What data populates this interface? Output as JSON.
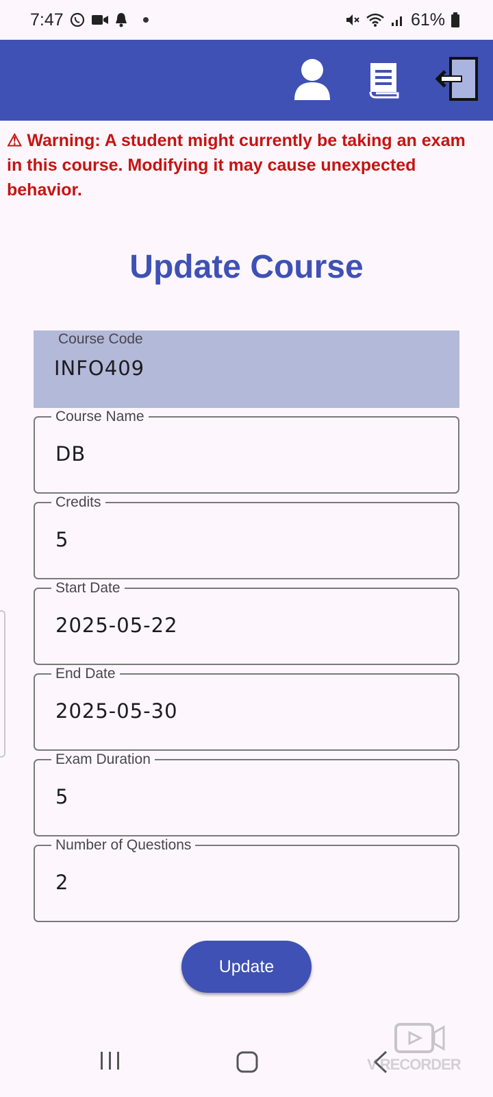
{
  "status_bar": {
    "time": "7:47",
    "battery": "61%",
    "icons": [
      "whatsapp-icon",
      "video-icon",
      "notification-bell-icon",
      "mute-icon",
      "wifi-icon",
      "signal-icon",
      "battery-icon"
    ]
  },
  "app_bar": {
    "color": "#3f51b5",
    "icons": [
      "profile-icon",
      "book-icon",
      "logout-icon"
    ]
  },
  "warning": {
    "text": "⚠ Warning: A student might currently be taking an exam in this course. Modifying it may cause unexpected behavior.",
    "color": "#c71313"
  },
  "page_title": "Update Course",
  "form": {
    "course_code": {
      "label": "Course Code",
      "value": "INFO409"
    },
    "course_name": {
      "label": "Course Name",
      "value": "DB"
    },
    "credits": {
      "label": "Credits",
      "value": "5"
    },
    "start_date": {
      "label": "Start Date",
      "value": "2025-05-22"
    },
    "end_date": {
      "label": "End Date",
      "value": "2025-05-30"
    },
    "exam_duration": {
      "label": "Exam Duration",
      "value": "5"
    },
    "num_questions": {
      "label": "Number of Questions",
      "value": "2"
    }
  },
  "update_button": {
    "label": "Update"
  },
  "nav_bar": {
    "icons": [
      "recents-icon",
      "home-icon",
      "back-icon"
    ]
  },
  "watermark": {
    "text": "V RECORDER"
  }
}
